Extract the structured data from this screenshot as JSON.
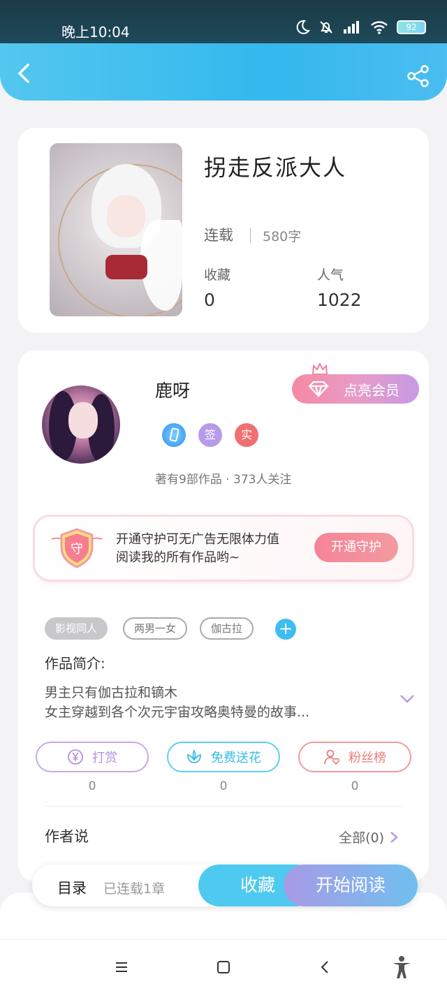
{
  "status_bar": {
    "time": "晚上10:04",
    "battery": "92"
  },
  "book": {
    "title": "拐走反派大人",
    "status": "连载",
    "words": "580字",
    "stats": [
      {
        "label": "收藏",
        "value": "0"
      },
      {
        "label": "人气",
        "value": "1022"
      }
    ]
  },
  "author": {
    "name": "鹿呀",
    "vip_button": "点亮会员",
    "badges": [
      {
        "text": "",
        "color": "#4aa8f5"
      },
      {
        "text": "签",
        "color": "#b79be8"
      },
      {
        "text": "实",
        "color": "#ef6f72"
      }
    ],
    "meta": "著有9部作品 · 373人关注"
  },
  "guard": {
    "icon_text": "守",
    "line1": "开通守护可无广告无限体力值",
    "line2": "阅读我的所有作品哟~",
    "button": "开通守护"
  },
  "tags": [
    "影视同人",
    "两男一女",
    "伽古拉"
  ],
  "intro": {
    "title": "作品简介:",
    "line1": "男主只有伽古拉和镝木",
    "line2": "女主穿越到各个次元宇宙攻略奥特曼的故事..."
  },
  "actions": [
    {
      "label": "打赏",
      "count": "0",
      "color": "#b99ae2"
    },
    {
      "label": "免费送花",
      "count": "0",
      "color": "#42c2ea"
    },
    {
      "label": "粉丝榜",
      "count": "0",
      "color": "#ef8c8c"
    }
  ],
  "author_say": {
    "title": "作者说",
    "all": "全部(0)"
  },
  "bottom": {
    "toc": "目录",
    "toc_sub": "已连载1章",
    "collect": "收藏",
    "read": "开始阅读"
  }
}
